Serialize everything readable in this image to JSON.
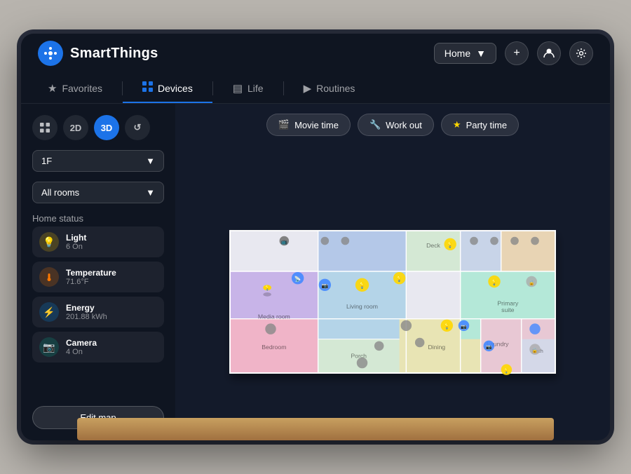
{
  "app": {
    "name": "SmartThings",
    "logo_char": "✿"
  },
  "top_bar": {
    "home_label": "Home",
    "add_label": "+",
    "profile_label": "👤",
    "settings_label": "⚙"
  },
  "nav": {
    "tabs": [
      {
        "id": "favorites",
        "label": "Favorites",
        "icon": "★",
        "active": false
      },
      {
        "id": "devices",
        "label": "Devices",
        "icon": "⊞",
        "active": true
      },
      {
        "id": "life",
        "label": "Life",
        "icon": "▤",
        "active": false
      },
      {
        "id": "routines",
        "label": "Routines",
        "icon": "▶",
        "active": false
      }
    ]
  },
  "sidebar": {
    "view_buttons": [
      {
        "id": "grid",
        "label": "⊞",
        "active": false
      },
      {
        "id": "2d",
        "label": "2D",
        "active": false
      },
      {
        "id": "3d",
        "label": "3D",
        "active": true
      },
      {
        "id": "history",
        "label": "↺",
        "active": false
      }
    ],
    "floor": {
      "value": "1F",
      "chevron": "▼"
    },
    "room": {
      "value": "All rooms",
      "chevron": "▼"
    },
    "home_status_label": "Home status",
    "status_items": [
      {
        "id": "light",
        "icon": "💡",
        "name": "Light",
        "value": "6 On",
        "type": "light"
      },
      {
        "id": "temperature",
        "icon": "🌡",
        "name": "Temperature",
        "value": "71.6°F",
        "type": "temp"
      },
      {
        "id": "energy",
        "icon": "⚡",
        "name": "Energy",
        "value": "201.88 kWh",
        "type": "energy"
      },
      {
        "id": "camera",
        "icon": "📷",
        "name": "Camera",
        "value": "4 On",
        "type": "camera"
      }
    ],
    "edit_map_label": "Edit map"
  },
  "scenes": [
    {
      "id": "movie",
      "icon": "🎬",
      "label": "Movie time"
    },
    {
      "id": "workout",
      "icon": "🔧",
      "label": "Work out"
    },
    {
      "id": "party",
      "icon": "⭐",
      "label": "Party time"
    }
  ],
  "colors": {
    "accent": "#1c73e8",
    "bg_dark": "#0f1521",
    "bg_main": "#131a2a",
    "active_tab": "#1c73e8"
  }
}
